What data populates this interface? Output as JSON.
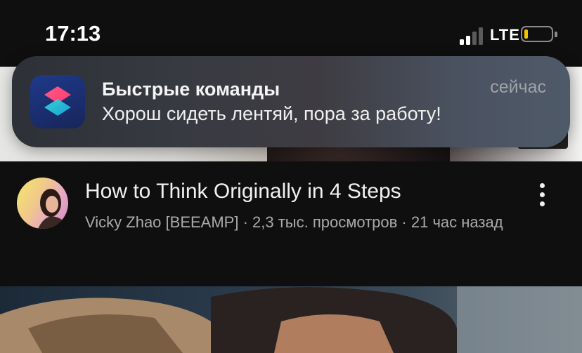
{
  "status_bar": {
    "time": "17:13",
    "network": "LTE",
    "battery_level": 0.15,
    "battery_color": "#f5c400"
  },
  "notification": {
    "app_name": "Быстрые команды",
    "time": "сейчас",
    "message": "Хорош сидеть лентяй, пора за работу!",
    "icon": "shortcuts-app-icon"
  },
  "video": {
    "title": "How to Think Originally in 4 Steps",
    "meta": "Vicky Zhao [BEEAMP] · 2,3 тыс. просмотров · 21 час назад",
    "more_icon": "more-vertical-icon"
  },
  "colors": {
    "background": "#0f0f0f",
    "secondary_text": "#aaaaaa",
    "primary_text": "#f1f1f1"
  }
}
